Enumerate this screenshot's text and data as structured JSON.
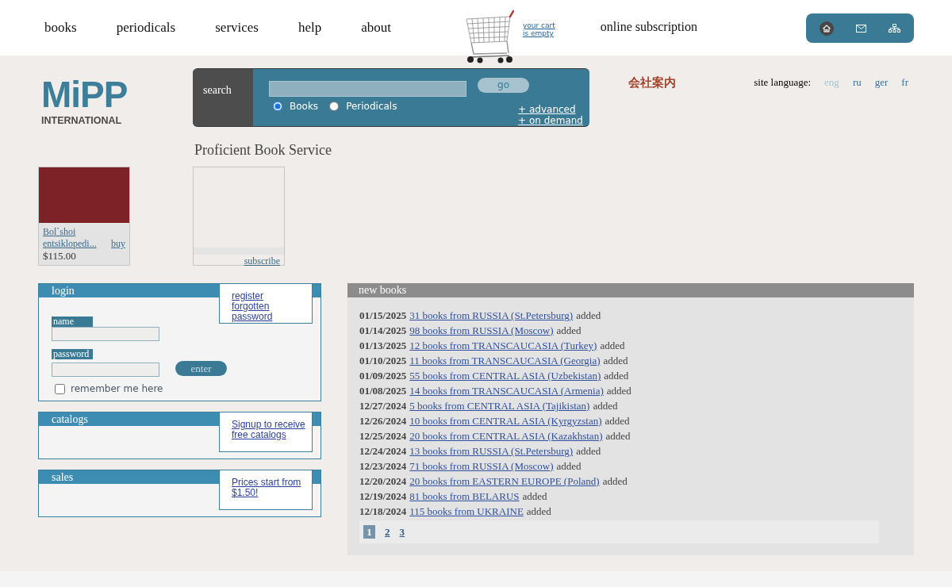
{
  "nav": [
    "books",
    "periodicals",
    "services",
    "help",
    "about"
  ],
  "cart": {
    "lines": [
      "your cart",
      "is empty"
    ]
  },
  "subscription_link": "online subscription",
  "toolbar": [
    {
      "kind": "home"
    },
    {
      "kind": "mail"
    },
    {
      "kind": "sitemap"
    }
  ],
  "logo": {
    "mark": "MiPP",
    "subtitle": "INTERNATIONAL"
  },
  "search": {
    "label": "search",
    "button": "go",
    "options": [
      {
        "label": "Books",
        "selected": true
      },
      {
        "label": "Periodicals",
        "selected": false
      }
    ],
    "links": [
      "+ advanced",
      "+ on demand"
    ]
  },
  "company_link": "会社案内",
  "language": {
    "label": "site language:",
    "options": [
      {
        "label": "eng",
        "selected": true
      },
      {
        "label": "ru",
        "selected": false
      },
      {
        "label": "ger",
        "selected": false
      },
      {
        "label": "fr",
        "selected": false
      }
    ]
  },
  "tagline": "Proficient Book Service",
  "products": [
    {
      "kind": "book",
      "title": "Bol`shoi entsiklopedi...",
      "action": "buy",
      "price": "$115.00"
    },
    {
      "kind": "subscription",
      "action": "subscribe"
    }
  ],
  "panels": [
    {
      "kind": "login",
      "title": "login",
      "links": [
        "register",
        "forgotten password"
      ],
      "fields": [
        {
          "label": "name"
        },
        {
          "label": "password"
        }
      ],
      "button": "enter",
      "remember": {
        "label": "remember me here",
        "checked": false
      }
    },
    {
      "kind": "info",
      "title": "catalogs",
      "links": [
        "Signup to receive free catalogs"
      ]
    },
    {
      "kind": "info",
      "title": "sales",
      "links": [
        "Prices start from $1.50!"
      ]
    }
  ],
  "new_books": {
    "title": "new books",
    "rows": [
      {
        "date": "01/15/2025",
        "link": "31 books from RUSSIA (St.Petersburg)",
        "suffix": "added"
      },
      {
        "date": "01/14/2025",
        "link": "98 books from RUSSIA (Moscow)",
        "suffix": "added"
      },
      {
        "date": "01/13/2025",
        "link": "12 books from TRANSCAUCASIA (Turkey)",
        "suffix": "added"
      },
      {
        "date": "01/10/2025",
        "link": "11 books from TRANSCAUCASIA (Georgia)",
        "suffix": "added"
      },
      {
        "date": "01/09/2025",
        "link": "55 books from CENTRAL ASIA (Uzbekistan)",
        "suffix": "added"
      },
      {
        "date": "01/08/2025",
        "link": "14 books from TRANSCAUCASIA (Armenia)",
        "suffix": "added"
      },
      {
        "date": "12/27/2024",
        "link": "5 books from CENTRAL ASIA (Tajikistan)",
        "suffix": "added"
      },
      {
        "date": "12/26/2024",
        "link": "10 books from CENTRAL ASIA (Kyrgyzstan)",
        "suffix": "added"
      },
      {
        "date": "12/25/2024",
        "link": "20 books from CENTRAL ASIA (Kazakhstan)",
        "suffix": "added"
      },
      {
        "date": "12/24/2024",
        "link": "13 books from RUSSIA (St.Petersburg)",
        "suffix": "added"
      },
      {
        "date": "12/23/2024",
        "link": "71 books from RUSSIA (Moscow)",
        "suffix": "added"
      },
      {
        "date": "12/20/2024",
        "link": "20 books from EASTERN EUROPE (Poland)",
        "suffix": "added"
      },
      {
        "date": "12/19/2024",
        "link": "81 books from BELARUS",
        "suffix": "added"
      },
      {
        "date": "12/18/2024",
        "link": "115 books from UKRAINE",
        "suffix": "added"
      }
    ],
    "pages": [
      {
        "label": "1",
        "selected": true
      },
      {
        "label": "2",
        "selected": false
      },
      {
        "label": "3",
        "selected": false
      }
    ]
  }
}
